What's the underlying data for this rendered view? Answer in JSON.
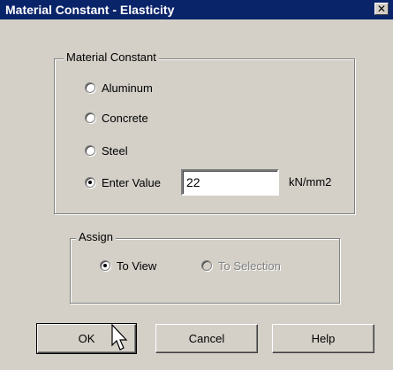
{
  "window": {
    "title": "Material Constant - Elasticity",
    "close_glyph": "✕"
  },
  "material_group": {
    "label": "Material Constant",
    "options": [
      "Aluminum",
      "Concrete",
      "Steel",
      "Enter Value"
    ],
    "selected": "Enter Value",
    "value": "22",
    "unit": "kN/mm2"
  },
  "assign_group": {
    "label": "Assign",
    "to_view": "To View",
    "to_selection": "To Selection",
    "selected": "To View"
  },
  "buttons": {
    "ok": "OK",
    "cancel": "Cancel",
    "help": "Help"
  }
}
